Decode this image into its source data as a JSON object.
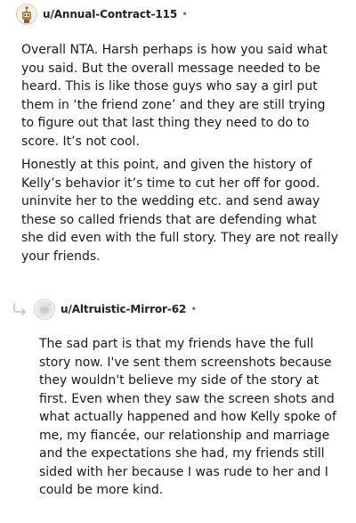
{
  "comment1": {
    "username": "u/Annual-Contract-115",
    "separator": "•",
    "avatar_icon": "robot-avatar-icon",
    "paragraphs": [
      "Overall NTA. Harsh perhaps is how you said what you said. But the overall message needed to be heard. This is like those guys who say a girl put them in ‘the friend zone’ and they are still trying to figure out that last thing they need to do to score. It’s not cool.",
      "Honestly at this point, and given the history of Kelly’s behavior it’s time to cut her off for good. uninvite her to the wedding etc. and send away these so called friends that are defending what she did even with the full story. They are not really your friends."
    ]
  },
  "comment2": {
    "username": "u/Altruistic-Mirror-62",
    "separator": "•",
    "avatar_icon": "default-avatar-icon",
    "reply_icon": "reply-arrow-icon",
    "paragraphs": [
      "The sad part is that my friends have the full story now. I've sent them screenshots because they wouldn't believe my side of the story at first. Even when they saw the screen shots and what actually happened and how Kelly spoke of me, my fiancée, our relationship and marriage and the expectations she had, my friends still sided with her because I was rude to her and I could be more kind."
    ]
  },
  "colors": {
    "text": "#1a1a1b",
    "meta": "#7c7c7c",
    "reply_arrow": "#b8c5d6"
  }
}
